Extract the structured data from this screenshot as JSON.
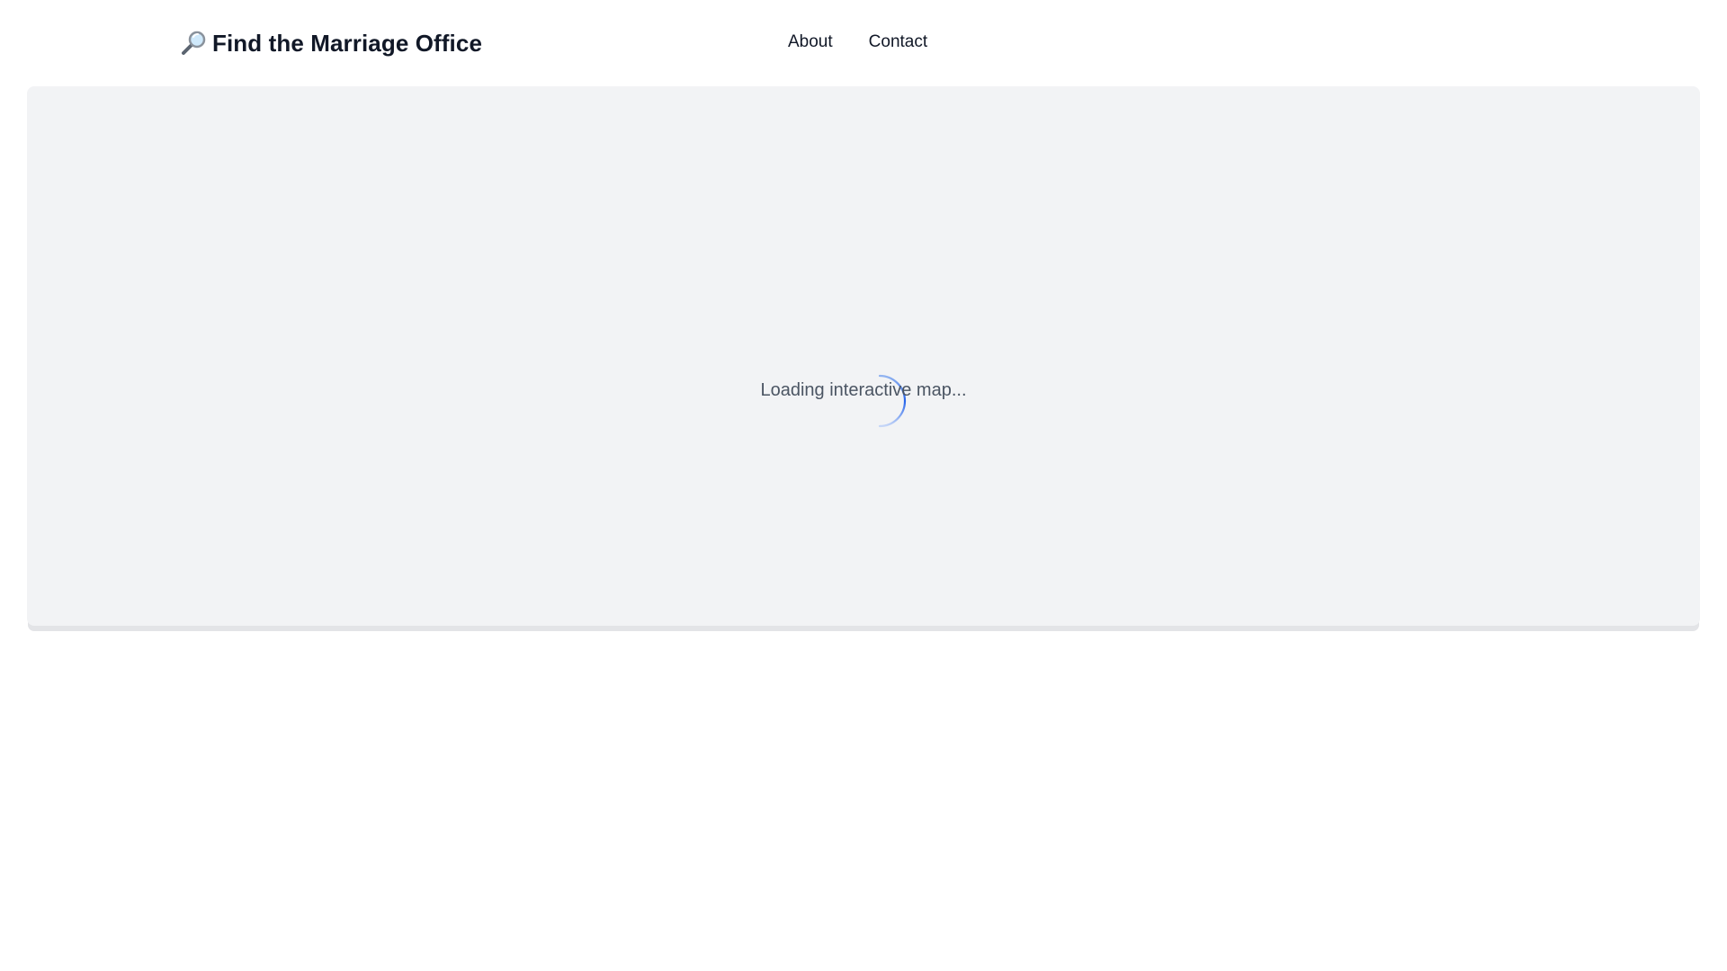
{
  "header": {
    "brand": {
      "icon": "magnifier-icon",
      "title": "Find the Marriage Office"
    },
    "nav": {
      "about_label": "About",
      "contact_label": "Contact"
    }
  },
  "map": {
    "loading_text": "Loading interactive map...",
    "spinner_icon": "loading-spinner-icon",
    "accent_color": "#2563eb",
    "background_color": "#f2f3f5"
  }
}
